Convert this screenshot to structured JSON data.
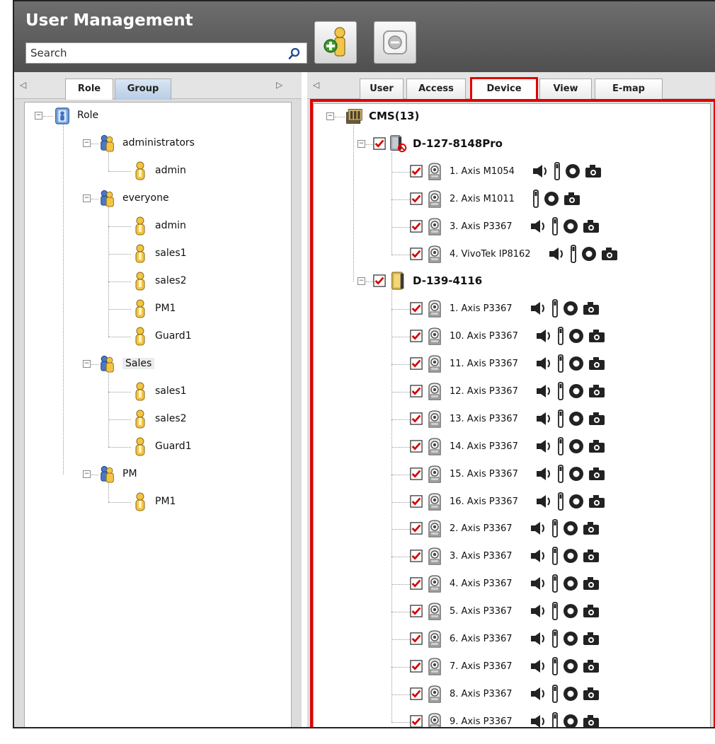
{
  "app": {
    "title": "User Management",
    "search_placeholder": "Search"
  },
  "toolbar": {
    "add_user_icon": "add-user-icon",
    "remove_icon": "remove-icon"
  },
  "left_tabs": [
    "Role",
    "Group"
  ],
  "right_tabs": [
    "User",
    "Access",
    "Device",
    "View",
    "E-map"
  ],
  "highlight_color": "#e00000",
  "role_tree": {
    "root": "Role",
    "groups": [
      {
        "name": "administrators",
        "members": [
          "admin"
        ]
      },
      {
        "name": "everyone",
        "members": [
          "admin",
          "sales1",
          "sales2",
          "PM1",
          "Guard1"
        ]
      },
      {
        "name": "Sales",
        "members": [
          "sales1",
          "sales2",
          "Guard1"
        ]
      },
      {
        "name": "PM",
        "members": [
          "PM1"
        ]
      }
    ]
  },
  "device_tree": {
    "root": "CMS(13)",
    "servers": [
      {
        "name": "D-127-8148Pro",
        "cameras": [
          {
            "name": "1. Axis M1054",
            "tools": [
              "speaker",
              "io",
              "record",
              "snapshot"
            ]
          },
          {
            "name": "2. Axis M1011",
            "tools": [
              "io",
              "record",
              "snapshot"
            ]
          },
          {
            "name": "3. Axis P3367",
            "tools": [
              "speaker",
              "io",
              "record",
              "snapshot"
            ]
          },
          {
            "name": "4. VivoTek IP8162",
            "tools": [
              "speaker",
              "io",
              "record",
              "snapshot"
            ]
          }
        ]
      },
      {
        "name": "D-139-4116",
        "cameras": [
          {
            "name": "1. Axis P3367",
            "tools": [
              "speaker",
              "io",
              "record",
              "snapshot"
            ]
          },
          {
            "name": "10. Axis P3367",
            "tools": [
              "speaker",
              "io",
              "record",
              "snapshot"
            ]
          },
          {
            "name": "11. Axis P3367",
            "tools": [
              "speaker",
              "io",
              "record",
              "snapshot"
            ]
          },
          {
            "name": "12. Axis P3367",
            "tools": [
              "speaker",
              "io",
              "record",
              "snapshot"
            ]
          },
          {
            "name": "13. Axis P3367",
            "tools": [
              "speaker",
              "io",
              "record",
              "snapshot"
            ]
          },
          {
            "name": "14. Axis P3367",
            "tools": [
              "speaker",
              "io",
              "record",
              "snapshot"
            ]
          },
          {
            "name": "15. Axis P3367",
            "tools": [
              "speaker",
              "io",
              "record",
              "snapshot"
            ]
          },
          {
            "name": "16. Axis P3367",
            "tools": [
              "speaker",
              "io",
              "record",
              "snapshot"
            ]
          },
          {
            "name": "2. Axis P3367",
            "tools": [
              "speaker",
              "io",
              "record",
              "snapshot"
            ]
          },
          {
            "name": "3. Axis P3367",
            "tools": [
              "speaker",
              "io",
              "record",
              "snapshot"
            ]
          },
          {
            "name": "4. Axis P3367",
            "tools": [
              "speaker",
              "io",
              "record",
              "snapshot"
            ]
          },
          {
            "name": "5. Axis P3367",
            "tools": [
              "speaker",
              "io",
              "record",
              "snapshot"
            ]
          },
          {
            "name": "6. Axis P3367",
            "tools": [
              "speaker",
              "io",
              "record",
              "snapshot"
            ]
          },
          {
            "name": "7. Axis P3367",
            "tools": [
              "speaker",
              "io",
              "record",
              "snapshot"
            ]
          },
          {
            "name": "8. Axis P3367",
            "tools": [
              "speaker",
              "io",
              "record",
              "snapshot"
            ]
          },
          {
            "name": "9. Axis P3367",
            "tools": [
              "speaker",
              "io",
              "record",
              "snapshot"
            ]
          }
        ]
      }
    ]
  }
}
